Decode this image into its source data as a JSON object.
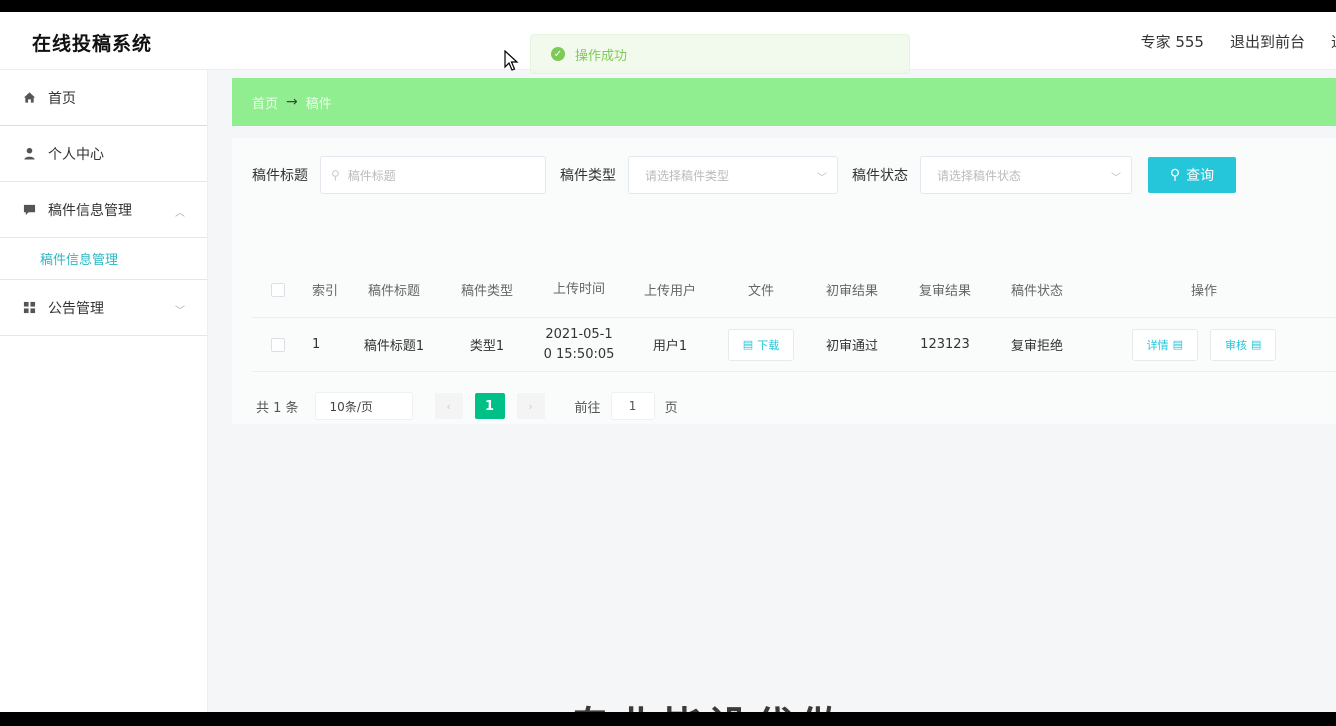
{
  "app": {
    "title": "在线投稿系统"
  },
  "header": {
    "user": "专家 555",
    "exit_front": "退出到前台",
    "exit_cut": "退"
  },
  "toast": {
    "message": "操作成功"
  },
  "sidebar": {
    "items": [
      {
        "label": "首页",
        "icon": "home-icon"
      },
      {
        "label": "个人中心",
        "icon": "user-icon"
      },
      {
        "label": "稿件信息管理",
        "icon": "message-icon"
      },
      {
        "label": "公告管理",
        "icon": "grid-icon"
      }
    ],
    "sub_item": "稿件信息管理"
  },
  "breadcrumb": {
    "home": "首页",
    "current": "稿件"
  },
  "search": {
    "title_label": "稿件标题",
    "title_placeholder": "稿件标题",
    "type_label": "稿件类型",
    "type_placeholder": "请选择稿件类型",
    "status_label": "稿件状态",
    "status_placeholder": "请选择稿件状态",
    "query_label": "查询"
  },
  "table": {
    "headers": [
      "索引",
      "稿件标题",
      "稿件类型",
      "上传时间",
      "上传用户",
      "文件",
      "初审结果",
      "复审结果",
      "稿件状态",
      "操作"
    ],
    "rows": [
      {
        "index": "1",
        "title": "稿件标题1",
        "type": "类型1",
        "time_line1": "2021-05-1",
        "time_line2": "0 15:50:05",
        "user": "用户1",
        "file_btn": "下载",
        "first": "初审通过",
        "second": "123123",
        "status": "复审拒绝",
        "op1": "详情",
        "op2": "审核"
      }
    ]
  },
  "pager": {
    "total": "共 1 条",
    "size": "10条/页",
    "page": "1",
    "goto_label": "前往",
    "goto_value": "1",
    "page_suffix": "页"
  },
  "overlay": {
    "text": "专业毕设代做"
  },
  "colors": {
    "accent": "#26c6da",
    "breadcrumb_bg": "#90ee90",
    "pager_active": "#00c087"
  }
}
